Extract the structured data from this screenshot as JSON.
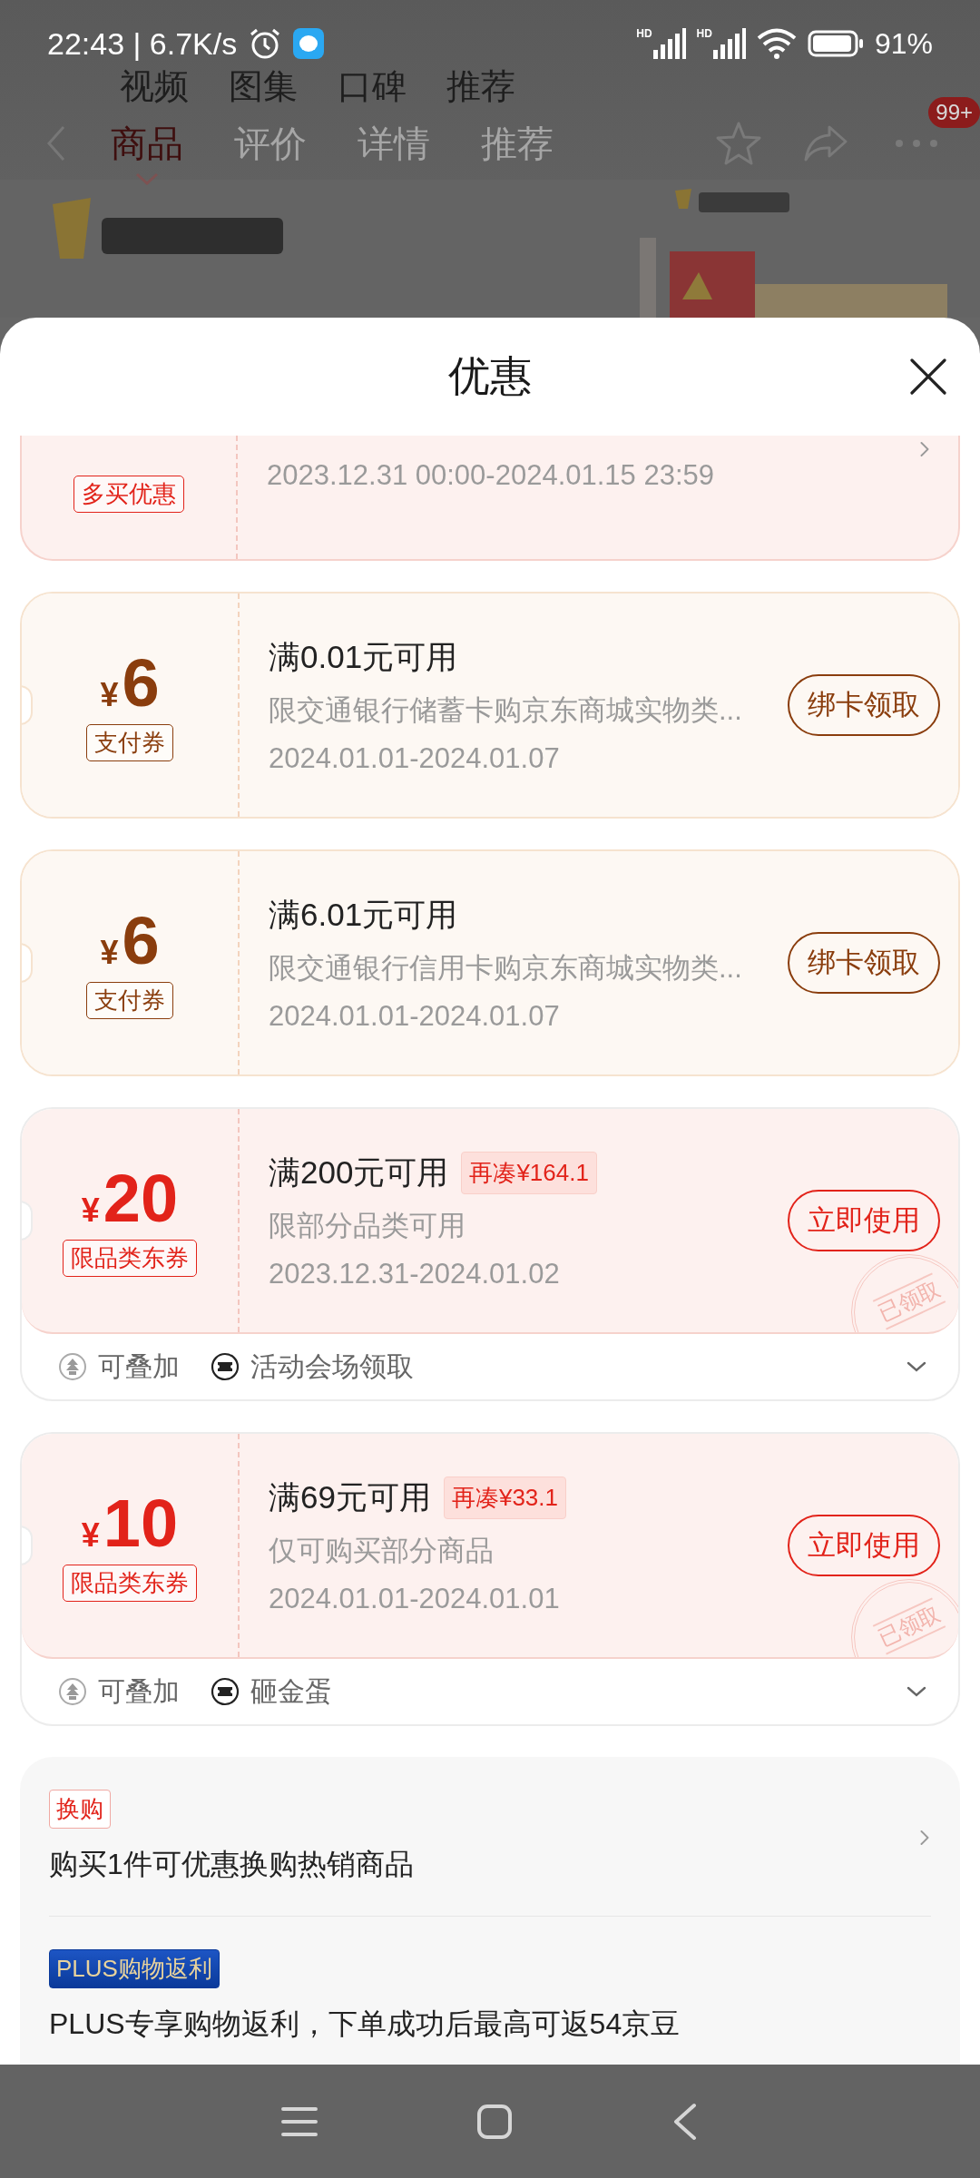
{
  "status_bar": {
    "time": "22:43 | 6.7K/s",
    "signals": [
      {
        "label": "HD"
      },
      {
        "label": "HD"
      }
    ],
    "battery": "91%"
  },
  "background_page": {
    "media_tabs": [
      "视频",
      "图集",
      "口碑",
      "推荐"
    ],
    "nav_tabs": [
      {
        "label": "商品",
        "selected": true
      },
      {
        "label": "评价",
        "selected": false
      },
      {
        "label": "详情",
        "selected": false
      },
      {
        "label": "推荐",
        "selected": false
      }
    ],
    "badge": "99+"
  },
  "sheet": {
    "title": "优惠",
    "top_offer": {
      "tag": "多买优惠",
      "dates": "2023.12.31 00:00-2024.01.15 23:59"
    },
    "coupons": [
      {
        "kind": "payment",
        "currency": "¥",
        "amount": "6",
        "tag": "支付券",
        "title": "满0.01元可用",
        "description": "限交通银行储蓄卡购京东商城实物类...",
        "dates": "2024.01.01-2024.01.07",
        "button": "绑卡领取"
      },
      {
        "kind": "payment",
        "currency": "¥",
        "amount": "6",
        "tag": "支付券",
        "title": "满6.01元可用",
        "description": "限交通银行信用卡购京东商城实物类...",
        "dates": "2024.01.01-2024.01.07",
        "button": "绑卡领取"
      },
      {
        "kind": "category",
        "currency": "¥",
        "amount": "20",
        "tag": "限品类东券",
        "title": "满200元可用",
        "shortfall": "再凑¥164.1",
        "description": "限部分品类可用",
        "dates": "2023.12.31-2024.01.02",
        "button": "立即使用",
        "stamp": "已领取",
        "features": [
          {
            "kind": "stackable",
            "label": "可叠加"
          },
          {
            "kind": "source",
            "label": "活动会场领取"
          }
        ]
      },
      {
        "kind": "category",
        "currency": "¥",
        "amount": "10",
        "tag": "限品类东券",
        "title": "满69元可用",
        "shortfall": "再凑¥33.1",
        "description": "仅可购买部分商品",
        "dates": "2024.01.01-2024.01.01",
        "button": "立即使用",
        "stamp": "已领取",
        "features": [
          {
            "kind": "stackable",
            "label": "可叠加"
          },
          {
            "kind": "source",
            "label": "砸金蛋"
          }
        ]
      }
    ],
    "promotions": [
      {
        "kind": "outline",
        "tag": "换购",
        "text": "购买1件可优惠换购热销商品",
        "link": true
      },
      {
        "kind": "plus",
        "tag": "PLUS购物返利",
        "text": "PLUS专享购物返利，下单成功后最高可返54京豆",
        "link": false
      }
    ]
  }
}
